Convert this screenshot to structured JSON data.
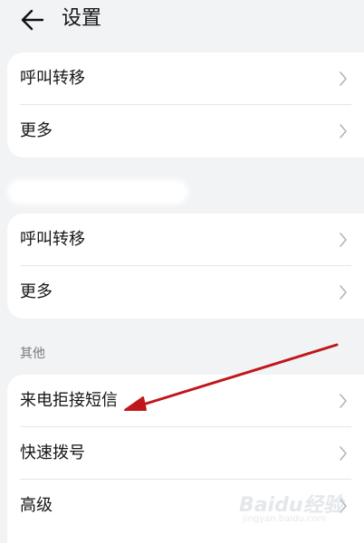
{
  "header": {
    "title": "设置",
    "back_icon": "back-arrow-icon"
  },
  "groups": [
    {
      "items": [
        {
          "label": "呼叫转移"
        },
        {
          "label": "更多"
        }
      ]
    },
    {
      "items": [
        {
          "label": "呼叫转移"
        },
        {
          "label": "更多"
        }
      ]
    },
    {
      "section_header": "其他",
      "items": [
        {
          "label": "来电拒接短信"
        },
        {
          "label": "快速拨号"
        },
        {
          "label": "高级"
        }
      ]
    }
  ],
  "annotation": {
    "arrow_color": "#c0171b"
  },
  "watermark": {
    "brand": "Baidu经验",
    "url": "jingyan.baidu.com"
  },
  "colors": {
    "background": "#f1f3f5",
    "card": "#ffffff",
    "chevron": "#b5b5b5"
  }
}
